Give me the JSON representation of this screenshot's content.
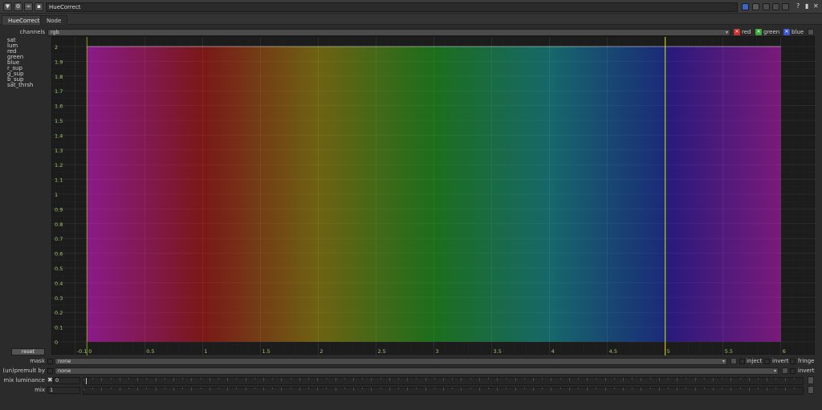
{
  "window": {
    "node_name": "HueCorrect",
    "collapse_glyph": "▼",
    "help_glyph": "?",
    "float_glyph": "▮",
    "close_glyph": "✕"
  },
  "tabs": [
    {
      "label": "HueCorrect",
      "active": true
    },
    {
      "label": "Node",
      "active": false
    }
  ],
  "channels": {
    "label": "channels",
    "value": "rgb",
    "checks": [
      {
        "label": "red",
        "color": "#c8302c"
      },
      {
        "label": "green",
        "color": "#3aa83a"
      },
      {
        "label": "blue",
        "color": "#3a56d0"
      }
    ]
  },
  "curves": [
    "sat",
    "lum",
    "red",
    "green",
    "blue",
    "r_sup",
    "g_sup",
    "b_sup",
    "sat_thrsh"
  ],
  "graph": {
    "y_ticks": [
      "2",
      "1.9",
      "1.8",
      "1.7",
      "1.6",
      "1.5",
      "1.4",
      "1.3",
      "1.2",
      "1.1",
      "1",
      "0.9",
      "0.8",
      "0.7",
      "0.6",
      "0.5",
      "0.4",
      "0.3",
      "0.2",
      "0.1",
      "0"
    ],
    "x_ticks": [
      "-0.1",
      "0",
      "0.5",
      "1",
      "1.5",
      "2",
      "2.5",
      "3",
      "3.5",
      "4",
      "4.5",
      "5",
      "5.5",
      "6"
    ],
    "hue_range": [
      0,
      6
    ],
    "curve_value": 2,
    "cursor_x": 5,
    "cursor_color": "#e8e000",
    "axis_color": "#9fc800"
  },
  "reset_label": "reset",
  "mask": {
    "label": "mask",
    "value": "none",
    "inject_label": "inject",
    "invert_label": "invert",
    "fringe_label": "fringe"
  },
  "premult": {
    "label": "(un)premult by",
    "value": "none",
    "invert_label": "invert"
  },
  "mix_luminance": {
    "label": "mix luminance",
    "value": "0"
  },
  "mix": {
    "label": "mix",
    "value": "1"
  }
}
